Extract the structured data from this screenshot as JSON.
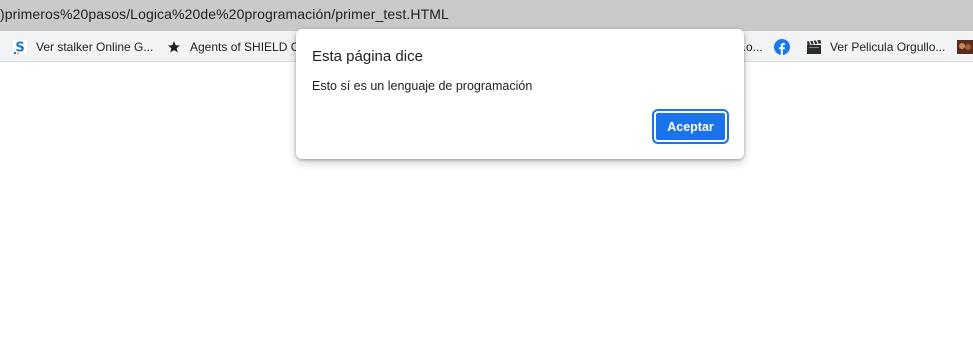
{
  "browser": {
    "url": ")primeros%20pasos/Logica%20de%20programación/primer_test.HTML"
  },
  "bookmarks": [
    {
      "label": "Ver stalker Online G...",
      "icon": "s-site-icon"
    },
    {
      "label": "Agents of SHIELD C...",
      "icon": "star-icon"
    },
    {
      "label": "...o...",
      "icon": "partial-icon"
    },
    {
      "label": "",
      "icon": "facebook-icon"
    },
    {
      "label": "Ver Pelicula Orgullo...",
      "icon": "clapperboard-icon"
    },
    {
      "label": "",
      "icon": "thumbnail-icon"
    }
  ],
  "dialog": {
    "title": "Esta página dice",
    "message": "Esto sí es un lenguaje de programación",
    "accept_label": "Aceptar"
  },
  "colors": {
    "address_bar_bg": "#c9c9c9",
    "bookmarks_bar_bg": "#f1f3f4",
    "accent": "#1a73e8",
    "facebook": "#1877f2"
  }
}
